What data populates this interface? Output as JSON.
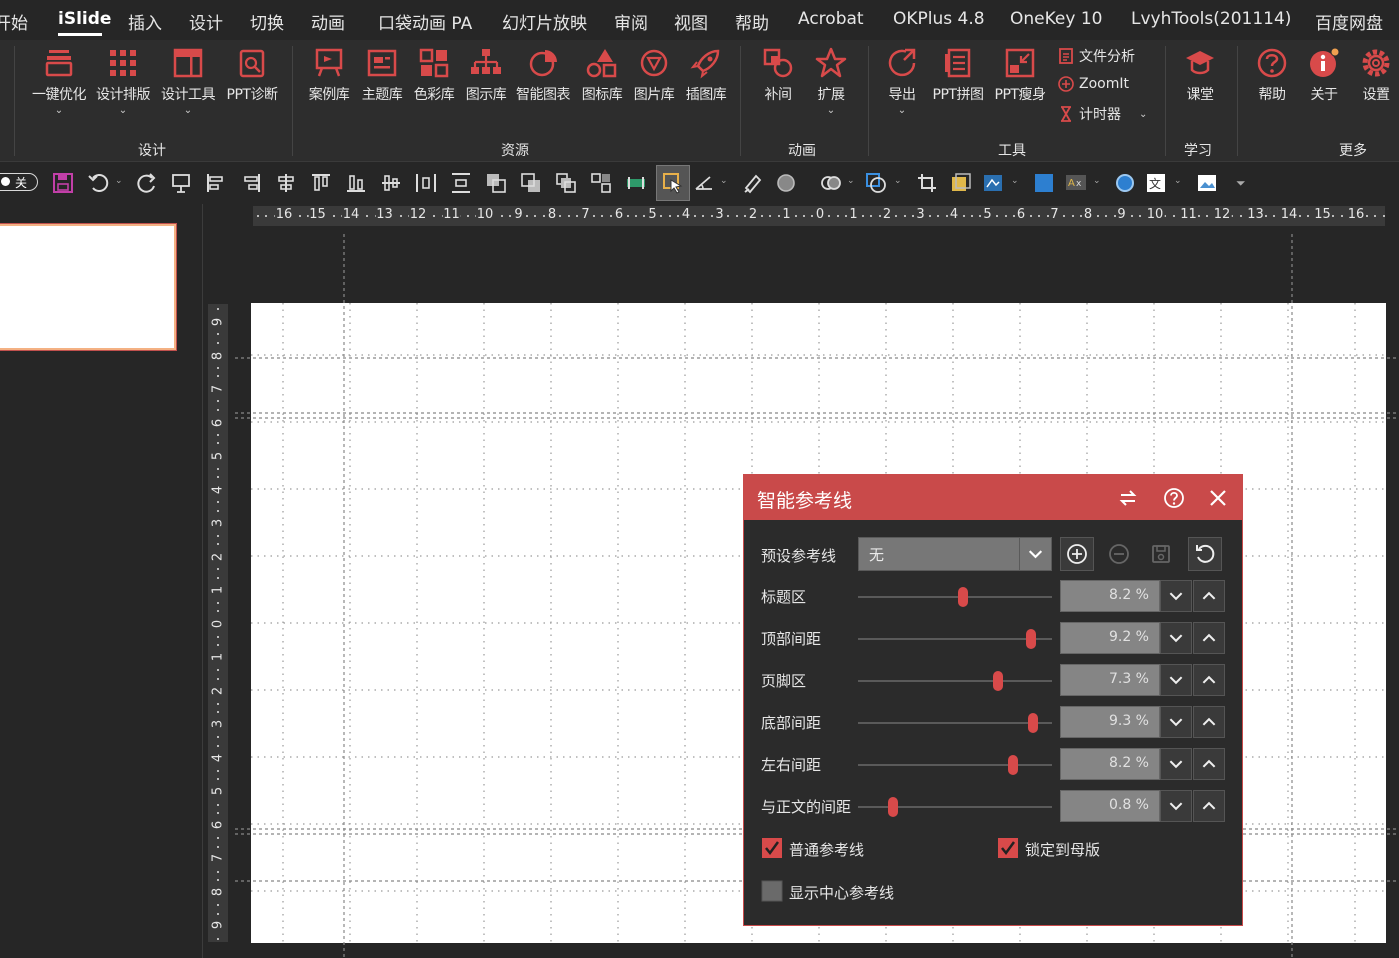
{
  "menu": {
    "tabs": [
      "开始",
      "iSlide",
      "插入",
      "设计",
      "切换",
      "动画",
      "口袋动画 PA",
      "幻灯片放映",
      "审阅",
      "视图",
      "帮助",
      "Acrobat",
      "OKPlus 4.8",
      "OneKey 10",
      "LvyhTools(201114)",
      "百度网盘"
    ],
    "active": "iSlide"
  },
  "ribbon": {
    "design": {
      "group_label": "设计",
      "buttons": [
        "一键优化",
        "设计排版",
        "设计工具",
        "PPT诊断"
      ]
    },
    "resources": {
      "group_label": "资源",
      "buttons": [
        "案例库",
        "主题库",
        "色彩库",
        "图示库",
        "智能图表",
        "图标库",
        "图片库",
        "插图库"
      ]
    },
    "animation": {
      "group_label": "动画",
      "buttons": [
        "补间",
        "扩展"
      ]
    },
    "tools": {
      "group_label": "工具",
      "buttons": [
        "导出",
        "PPT拼图",
        "PPT瘦身"
      ],
      "small_buttons": [
        "文件分析",
        "ZoomIt",
        "计时器"
      ]
    },
    "learn": {
      "group_label": "学习",
      "buttons": [
        "课堂"
      ]
    },
    "more": {
      "group_label": "更多",
      "buttons": [
        "帮助",
        "关于",
        "设置"
      ]
    }
  },
  "qat": {
    "toggle_label": "关"
  },
  "rulers": {
    "horizontal": [
      "16",
      "15",
      "14",
      "13",
      "12",
      "11",
      "10",
      "9",
      "8",
      "7",
      "6",
      "5",
      "4",
      "3",
      "2",
      "1",
      "0",
      "1",
      "2",
      "3",
      "4",
      "5",
      "6",
      "7",
      "8",
      "9",
      "10",
      "11",
      "12",
      "13",
      "14",
      "15",
      "16"
    ],
    "vertical": [
      "9",
      "8",
      "7",
      "6",
      "5",
      "4",
      "3",
      "2",
      "1",
      "0",
      "1",
      "2",
      "3",
      "4",
      "5",
      "6",
      "7",
      "8",
      "9"
    ]
  },
  "dialog": {
    "title": "智能参考线",
    "preset": {
      "label": "预设参考线",
      "value": "无"
    },
    "rows": [
      {
        "label": "标题区",
        "value": "8.2 %",
        "slider": 0.54
      },
      {
        "label": "顶部间距",
        "value": "9.2 %",
        "slider": 0.89
      },
      {
        "label": "页脚区",
        "value": "7.3 %",
        "slider": 0.72
      },
      {
        "label": "底部间距",
        "value": "9.3 %",
        "slider": 0.9
      },
      {
        "label": "左右间距",
        "value": "8.2 %",
        "slider": 0.8
      },
      {
        "label": "与正文的间距",
        "value": "0.8 %",
        "slider": 0.18
      }
    ],
    "checkboxes": [
      {
        "label": "普通参考线",
        "checked": true
      },
      {
        "label": "锁定到母版",
        "checked": true
      },
      {
        "label": "显示中心参考线",
        "checked": false
      }
    ]
  },
  "colors": {
    "accent": "#d84a4a",
    "dialog_title_bg": "#c94a4a",
    "app_bg": "#262626",
    "ribbon_bg": "#2d2d2d",
    "thumb_border": "#f4b183"
  }
}
